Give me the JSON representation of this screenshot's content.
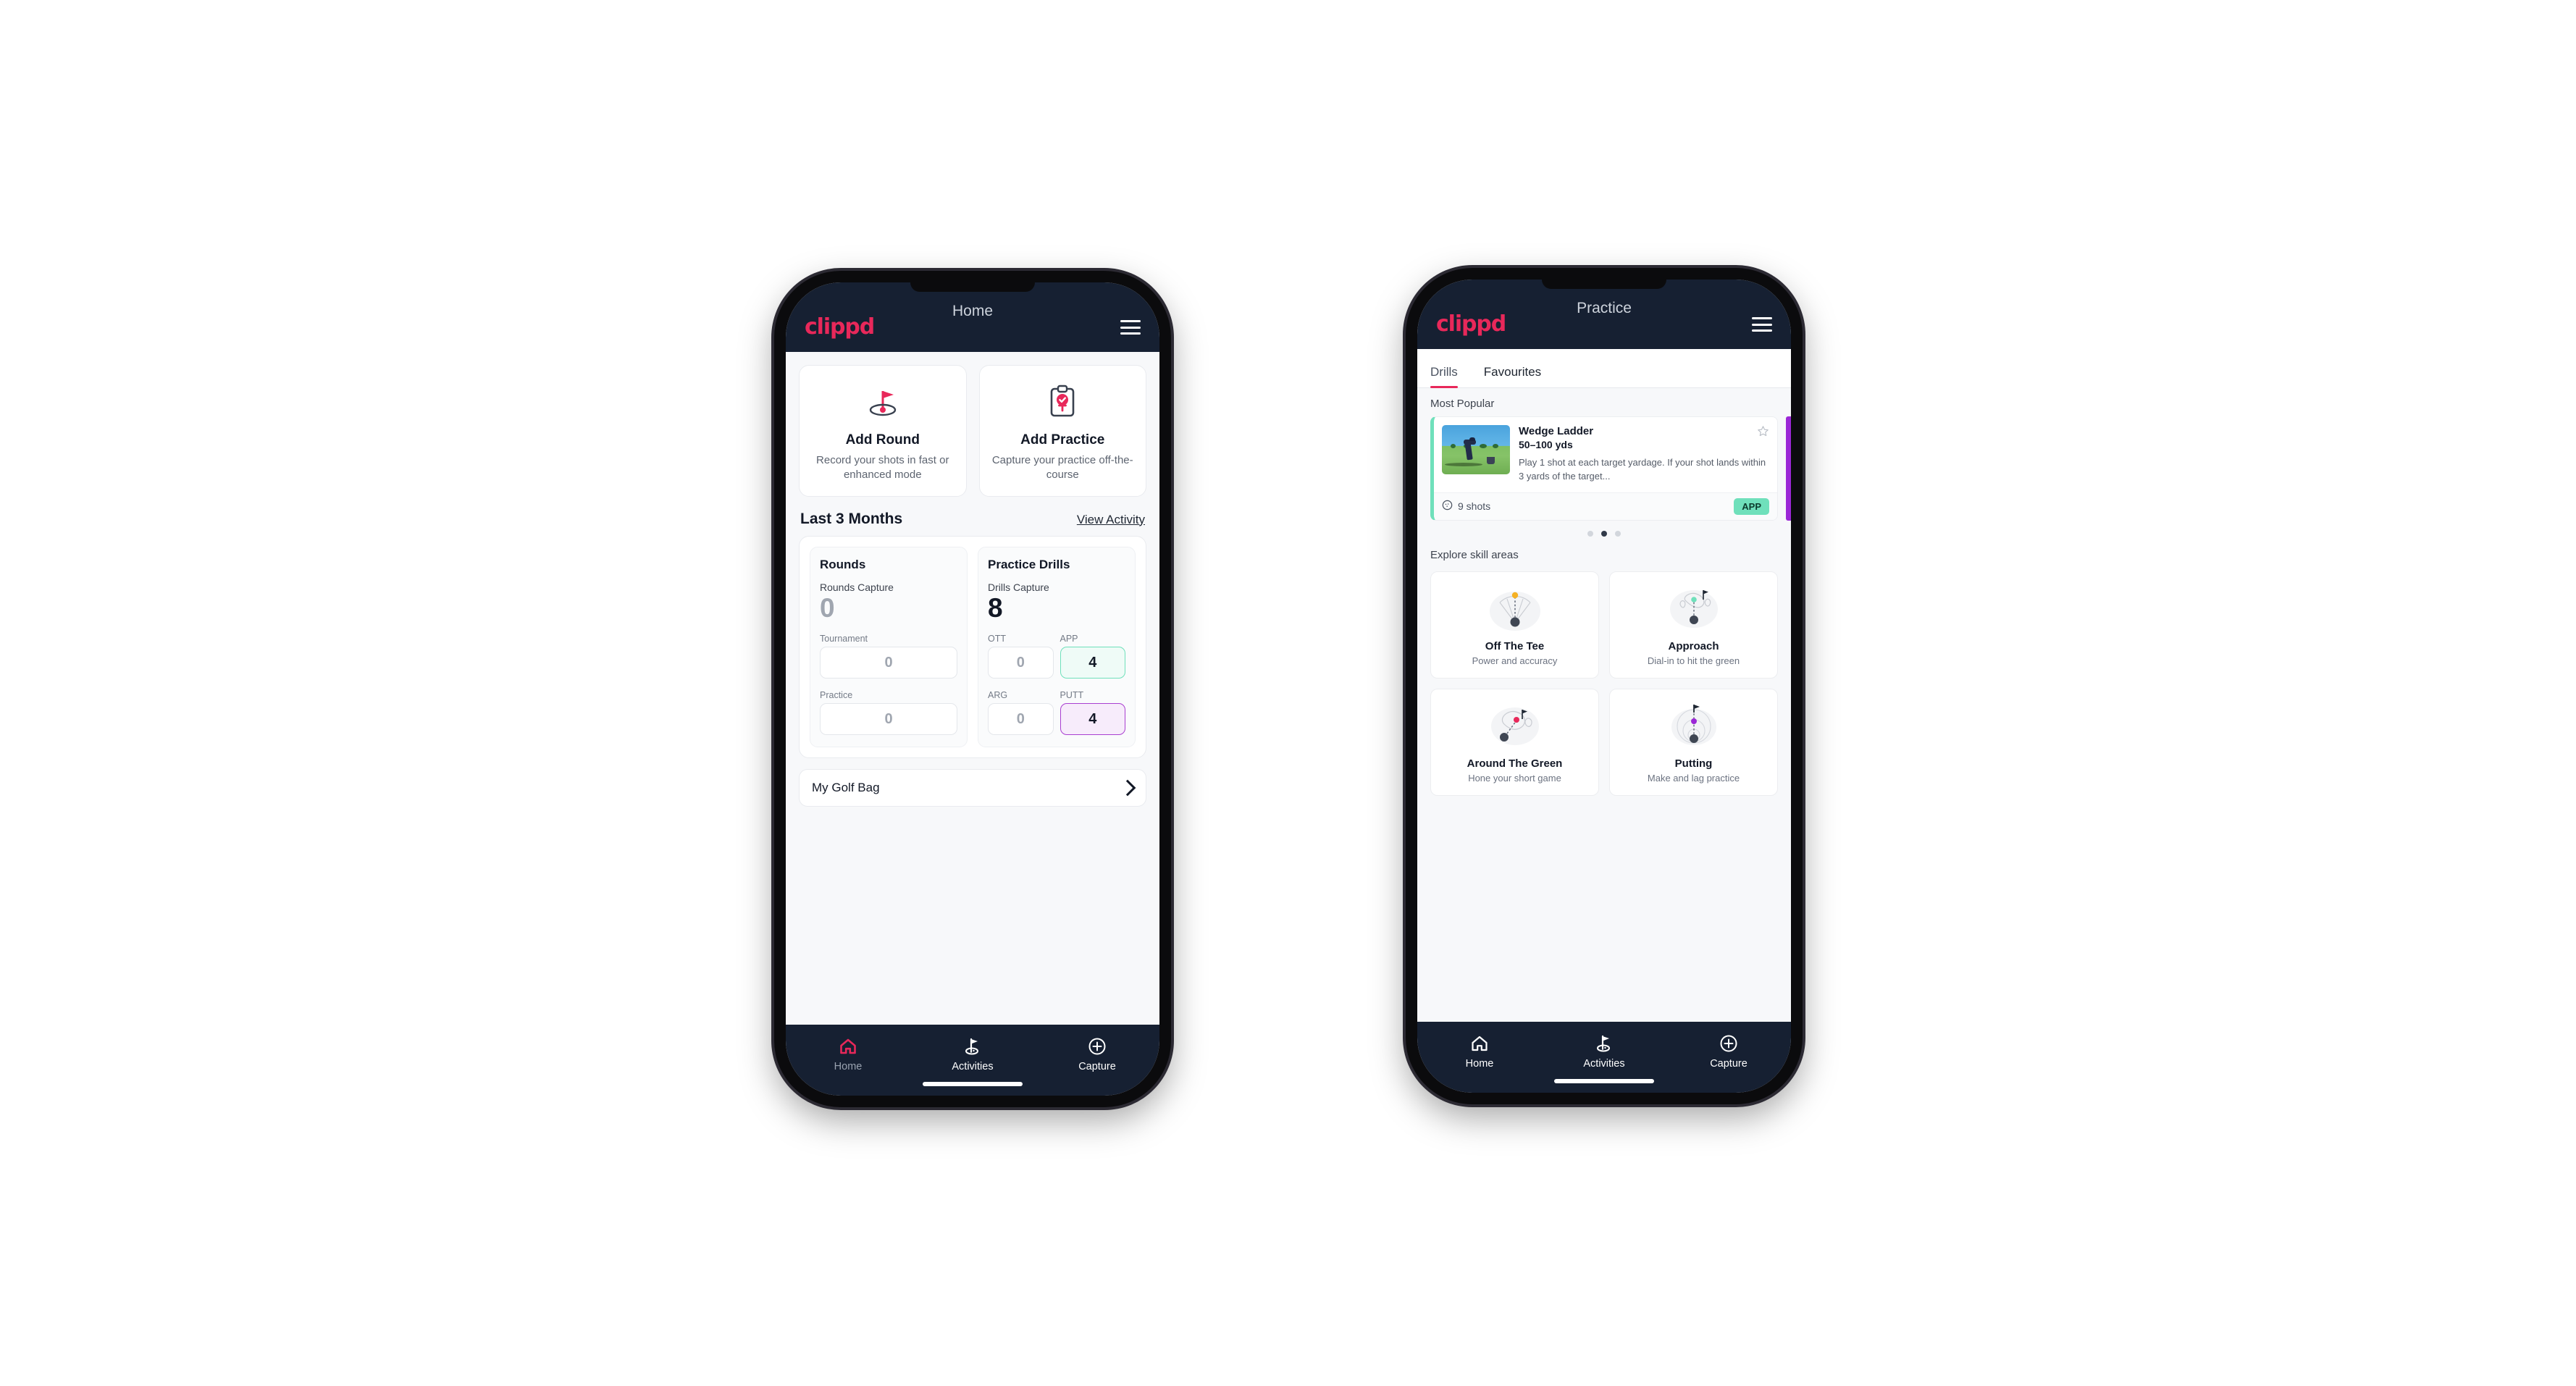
{
  "colors": {
    "brand_pink": "#e8285a",
    "appbar_navy": "#162032",
    "app_green": "#6fe0bb",
    "putt_purple": "#a93fd1",
    "peek_purple": "#9b27d6",
    "page_bg": "#f7f8fa"
  },
  "phone1": {
    "appbar": {
      "brand": "clippd",
      "title": "Home",
      "menu_icon": "hamburger-icon"
    },
    "quick_actions": [
      {
        "icon": "golf-flag-hole-icon",
        "title": "Add Round",
        "subtitle": "Record your shots in fast or enhanced mode"
      },
      {
        "icon": "clipboard-check-icon",
        "title": "Add Practice",
        "subtitle": "Capture your practice off-the-course"
      }
    ],
    "section": {
      "title": "Last 3 Months",
      "link": "View Activity"
    },
    "stats": {
      "rounds": {
        "heading": "Rounds",
        "capture_label": "Rounds Capture",
        "capture_value": "0",
        "rows": [
          {
            "label": "Tournament",
            "value": "0"
          },
          {
            "label": "Practice",
            "value": "0"
          }
        ]
      },
      "drills": {
        "heading": "Practice Drills",
        "capture_label": "Drills Capture",
        "capture_value": "8",
        "cells": [
          {
            "label": "OTT",
            "value": "0",
            "style": "plain"
          },
          {
            "label": "APP",
            "value": "4",
            "style": "app"
          },
          {
            "label": "ARG",
            "value": "0",
            "style": "plain"
          },
          {
            "label": "PUTT",
            "value": "4",
            "style": "putt"
          }
        ]
      }
    },
    "golf_bag": {
      "label": "My Golf Bag",
      "chevron": "chevron-right-icon"
    },
    "nav": [
      {
        "icon": "home-icon",
        "label": "Home",
        "state": "active"
      },
      {
        "icon": "golf-flag-icon",
        "label": "Activities",
        "state": "default"
      },
      {
        "icon": "plus-circle-icon",
        "label": "Capture",
        "state": "default"
      }
    ]
  },
  "phone2": {
    "appbar": {
      "brand": "clippd",
      "title": "Practice",
      "menu_icon": "hamburger-icon"
    },
    "tabs": [
      {
        "label": "Drills",
        "active": true
      },
      {
        "label": "Favourites",
        "active": false
      }
    ],
    "most_popular": {
      "caption": "Most Popular",
      "drill": {
        "title": "Wedge Ladder",
        "yardage": "50–100 yds",
        "description": "Play 1 shot at each target yardage. If your shot lands within 3 yards of the target...",
        "shots": "9 shots",
        "shots_icon": "golf-ball-icon",
        "badge": "APP",
        "favourite_icon": "star-outline-icon",
        "thumbnail": "golfer-practice-photo"
      },
      "dots": {
        "count": 3,
        "active_index": 1
      }
    },
    "skill_areas": {
      "caption": "Explore skill areas",
      "cards": [
        {
          "icon": "tee-fan-icon",
          "title": "Off The Tee",
          "subtitle": "Power and accuracy"
        },
        {
          "icon": "green-approach-icon",
          "title": "Approach",
          "subtitle": "Dial-in to hit the green"
        },
        {
          "icon": "chip-green-icon",
          "title": "Around The Green",
          "subtitle": "Hone your short game"
        },
        {
          "icon": "putting-rings-icon",
          "title": "Putting",
          "subtitle": "Make and lag practice"
        }
      ]
    },
    "nav": [
      {
        "icon": "home-icon",
        "label": "Home",
        "state": "default"
      },
      {
        "icon": "golf-flag-icon",
        "label": "Activities",
        "state": "active"
      },
      {
        "icon": "plus-circle-icon",
        "label": "Capture",
        "state": "default"
      }
    ]
  }
}
